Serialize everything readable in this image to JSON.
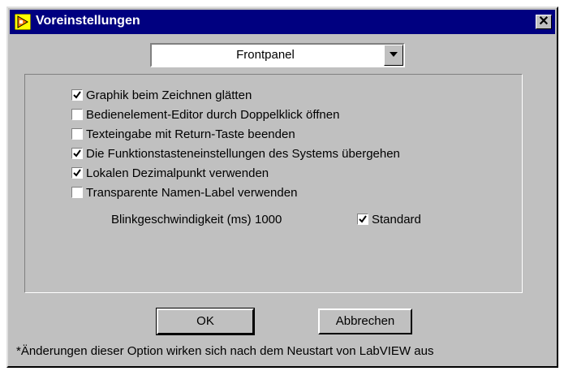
{
  "window": {
    "title": "Voreinstellungen",
    "close_glyph": "✕"
  },
  "category_select": {
    "value": "Frontpanel"
  },
  "options": [
    {
      "label": "Graphik beim Zeichnen glätten",
      "checked": true
    },
    {
      "label": "Bedienelement-Editor durch Doppelklick öffnen",
      "checked": false
    },
    {
      "label": "Texteingabe mit Return-Taste beenden",
      "checked": false
    },
    {
      "label": "Die Funktionstasteneinstellungen des Systems übergehen",
      "checked": true
    },
    {
      "label": "Lokalen Dezimalpunkt verwenden",
      "checked": true
    },
    {
      "label": "Transparente Namen-Label verwenden",
      "checked": false
    }
  ],
  "blink": {
    "label": "Blinkgeschwindigkeit (ms)",
    "value": "1000",
    "standard_label": "Standard",
    "standard_checked": true
  },
  "buttons": {
    "ok": "OK",
    "cancel": "Abbrechen"
  },
  "footer_note": "*Änderungen dieser Option wirken sich nach dem Neustart von LabVIEW aus",
  "colors": {
    "titlebar": "#000080",
    "face": "#c0c0c0"
  }
}
